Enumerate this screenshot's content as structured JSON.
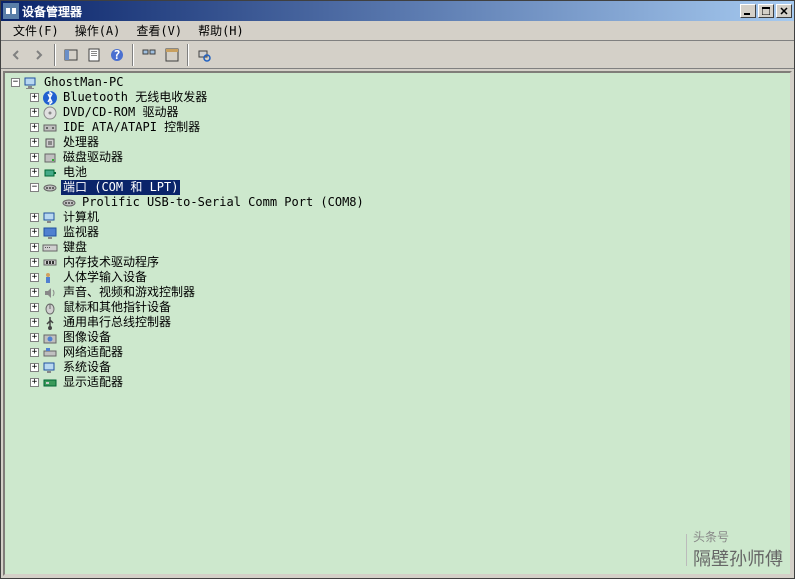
{
  "window": {
    "title": "设备管理器"
  },
  "menu": {
    "file": "文件(F)",
    "action": "操作(A)",
    "view": "查看(V)",
    "help": "帮助(H)"
  },
  "tree": {
    "root": "GhostMan-PC",
    "n0": "Bluetooth 无线电收发器",
    "n1": "DVD/CD-ROM 驱动器",
    "n2": "IDE ATA/ATAPI 控制器",
    "n3": "处理器",
    "n4": "磁盘驱动器",
    "n5": "电池",
    "n6": "端口 (COM 和 LPT)",
    "n6c": "Prolific USB-to-Serial Comm Port (COM8)",
    "n7": "计算机",
    "n8": "监视器",
    "n9": "键盘",
    "n10": "内存技术驱动程序",
    "n11": "人体学输入设备",
    "n12": "声音、视频和游戏控制器",
    "n13": "鼠标和其他指针设备",
    "n14": "通用串行总线控制器",
    "n15": "图像设备",
    "n16": "网络适配器",
    "n17": "系统设备",
    "n18": "显示适配器"
  },
  "watermark": {
    "a": "头条号",
    "b": "隔壁孙师傅"
  }
}
